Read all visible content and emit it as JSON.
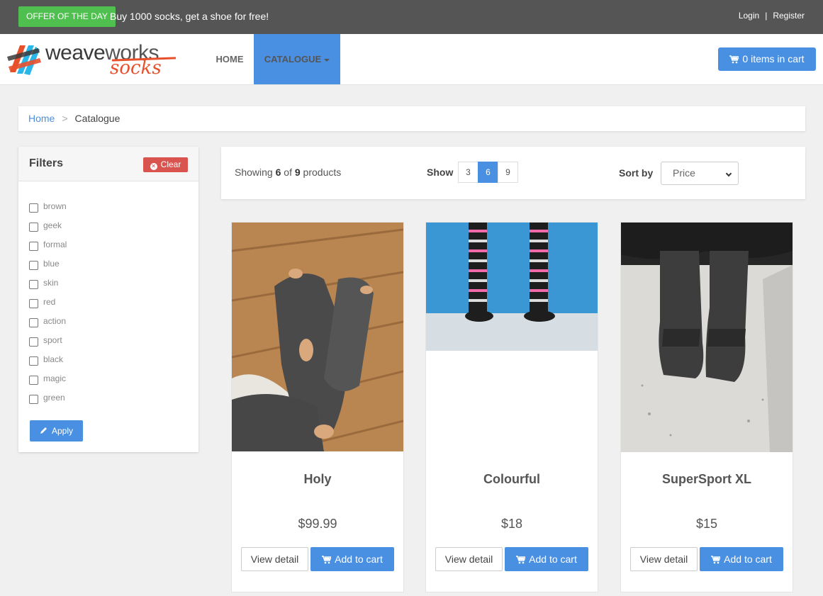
{
  "topbar": {
    "offer_badge": "OFFER OF THE DAY",
    "offer_text": "Buy 1000 socks, get a shoe for free!",
    "login": "Login",
    "separator": "|",
    "register": "Register"
  },
  "brand": {
    "word_a": "weave",
    "word_b": "works",
    "sub": "socks"
  },
  "nav": {
    "home": "HOME",
    "catalogue": "CATALOGUE",
    "cart": "0 items in cart"
  },
  "breadcrumb": {
    "home": "Home",
    "separator": ">",
    "current": "Catalogue"
  },
  "filters": {
    "title": "Filters",
    "clear": "Clear",
    "apply": "Apply",
    "items": [
      {
        "label": "brown",
        "checked": false
      },
      {
        "label": "geek",
        "checked": false
      },
      {
        "label": "formal",
        "checked": false
      },
      {
        "label": "blue",
        "checked": false
      },
      {
        "label": "skin",
        "checked": false
      },
      {
        "label": "red",
        "checked": false
      },
      {
        "label": "action",
        "checked": false
      },
      {
        "label": "sport",
        "checked": false
      },
      {
        "label": "black",
        "checked": false
      },
      {
        "label": "magic",
        "checked": false
      },
      {
        "label": "green",
        "checked": false
      }
    ]
  },
  "toolbar": {
    "showing_prefix": "Showing",
    "showing_count": "6",
    "showing_of": "of",
    "showing_total": "9",
    "showing_suffix": "products",
    "show_label": "Show",
    "page_sizes": [
      "3",
      "6",
      "9"
    ],
    "active_page_size": "6",
    "sort_label": "Sort by",
    "sort_value": "Price"
  },
  "products": [
    {
      "name": "Holy",
      "price": "$99.99",
      "view": "View detail",
      "add": "Add to cart"
    },
    {
      "name": "Colourful",
      "price": "$18",
      "view": "View detail",
      "add": "Add to cart"
    },
    {
      "name": "SuperSport XL",
      "price": "$15",
      "view": "View detail",
      "add": "Add to cart"
    }
  ],
  "colors": {
    "topbar": "#555555",
    "offer_green": "#4fbf4f",
    "accent_blue": "#4a90e2",
    "danger_red": "#d9534f",
    "brand_orange": "#e8502c"
  }
}
